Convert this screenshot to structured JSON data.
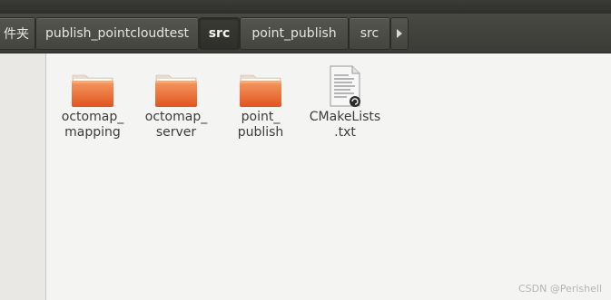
{
  "pathbar": {
    "crumbs": [
      {
        "label": "件夹",
        "active": false
      },
      {
        "label": "publish_pointcloudtest",
        "active": false
      },
      {
        "label": "src",
        "active": true
      },
      {
        "label": "point_publish",
        "active": false
      },
      {
        "label": "src",
        "active": false
      }
    ],
    "scroll_icon": "triangle-right-icon"
  },
  "files": [
    {
      "label": "octomap_\nmapping",
      "icon": "folder-icon"
    },
    {
      "label": "octomap_\nserver",
      "icon": "folder-icon"
    },
    {
      "label": "point_\npublish",
      "icon": "folder-icon"
    },
    {
      "label": "CMakeLists\n.txt",
      "icon": "text-file-icon"
    }
  ],
  "watermark": "CSDN @Perishell",
  "colors": {
    "folder_orange": "#e8622a",
    "folder_light": "#f39a63",
    "pathbar_bg": "#45453f",
    "content_bg": "#f4f4f3"
  }
}
